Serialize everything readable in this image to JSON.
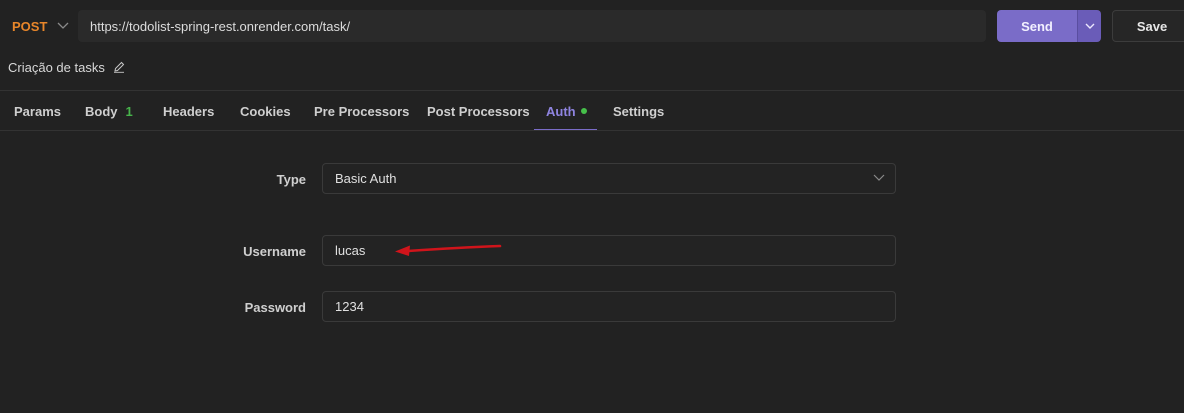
{
  "request": {
    "method": "POST",
    "url": "https://todolist-spring-rest.onrender.com/task/",
    "send_label": "Send",
    "save_label": "Save",
    "name": "Criação de tasks"
  },
  "tabs": [
    {
      "label": "Params"
    },
    {
      "label": "Body",
      "count": "1"
    },
    {
      "label": "Headers"
    },
    {
      "label": "Cookies"
    },
    {
      "label": "Pre Processors"
    },
    {
      "label": "Post Processors"
    },
    {
      "label": "Auth",
      "active": true,
      "indicator": "green-dot"
    },
    {
      "label": "Settings"
    }
  ],
  "auth": {
    "type_label": "Type",
    "type_value": "Basic Auth",
    "username_label": "Username",
    "username_value": "lucas",
    "password_label": "Password",
    "password_value": "1234"
  },
  "colors": {
    "method": "#e8862a",
    "accent": "#7a6cc8",
    "active_tab": "#8f84e0",
    "count": "#47b44b",
    "annotation_arrow": "#d0141b"
  },
  "icons": {
    "method_dropdown": "chevron-down-icon",
    "send_dropdown": "chevron-down-icon",
    "edit": "pencil-icon",
    "type_dropdown": "chevron-down-icon",
    "annotation": "red-arrow-annotation"
  }
}
